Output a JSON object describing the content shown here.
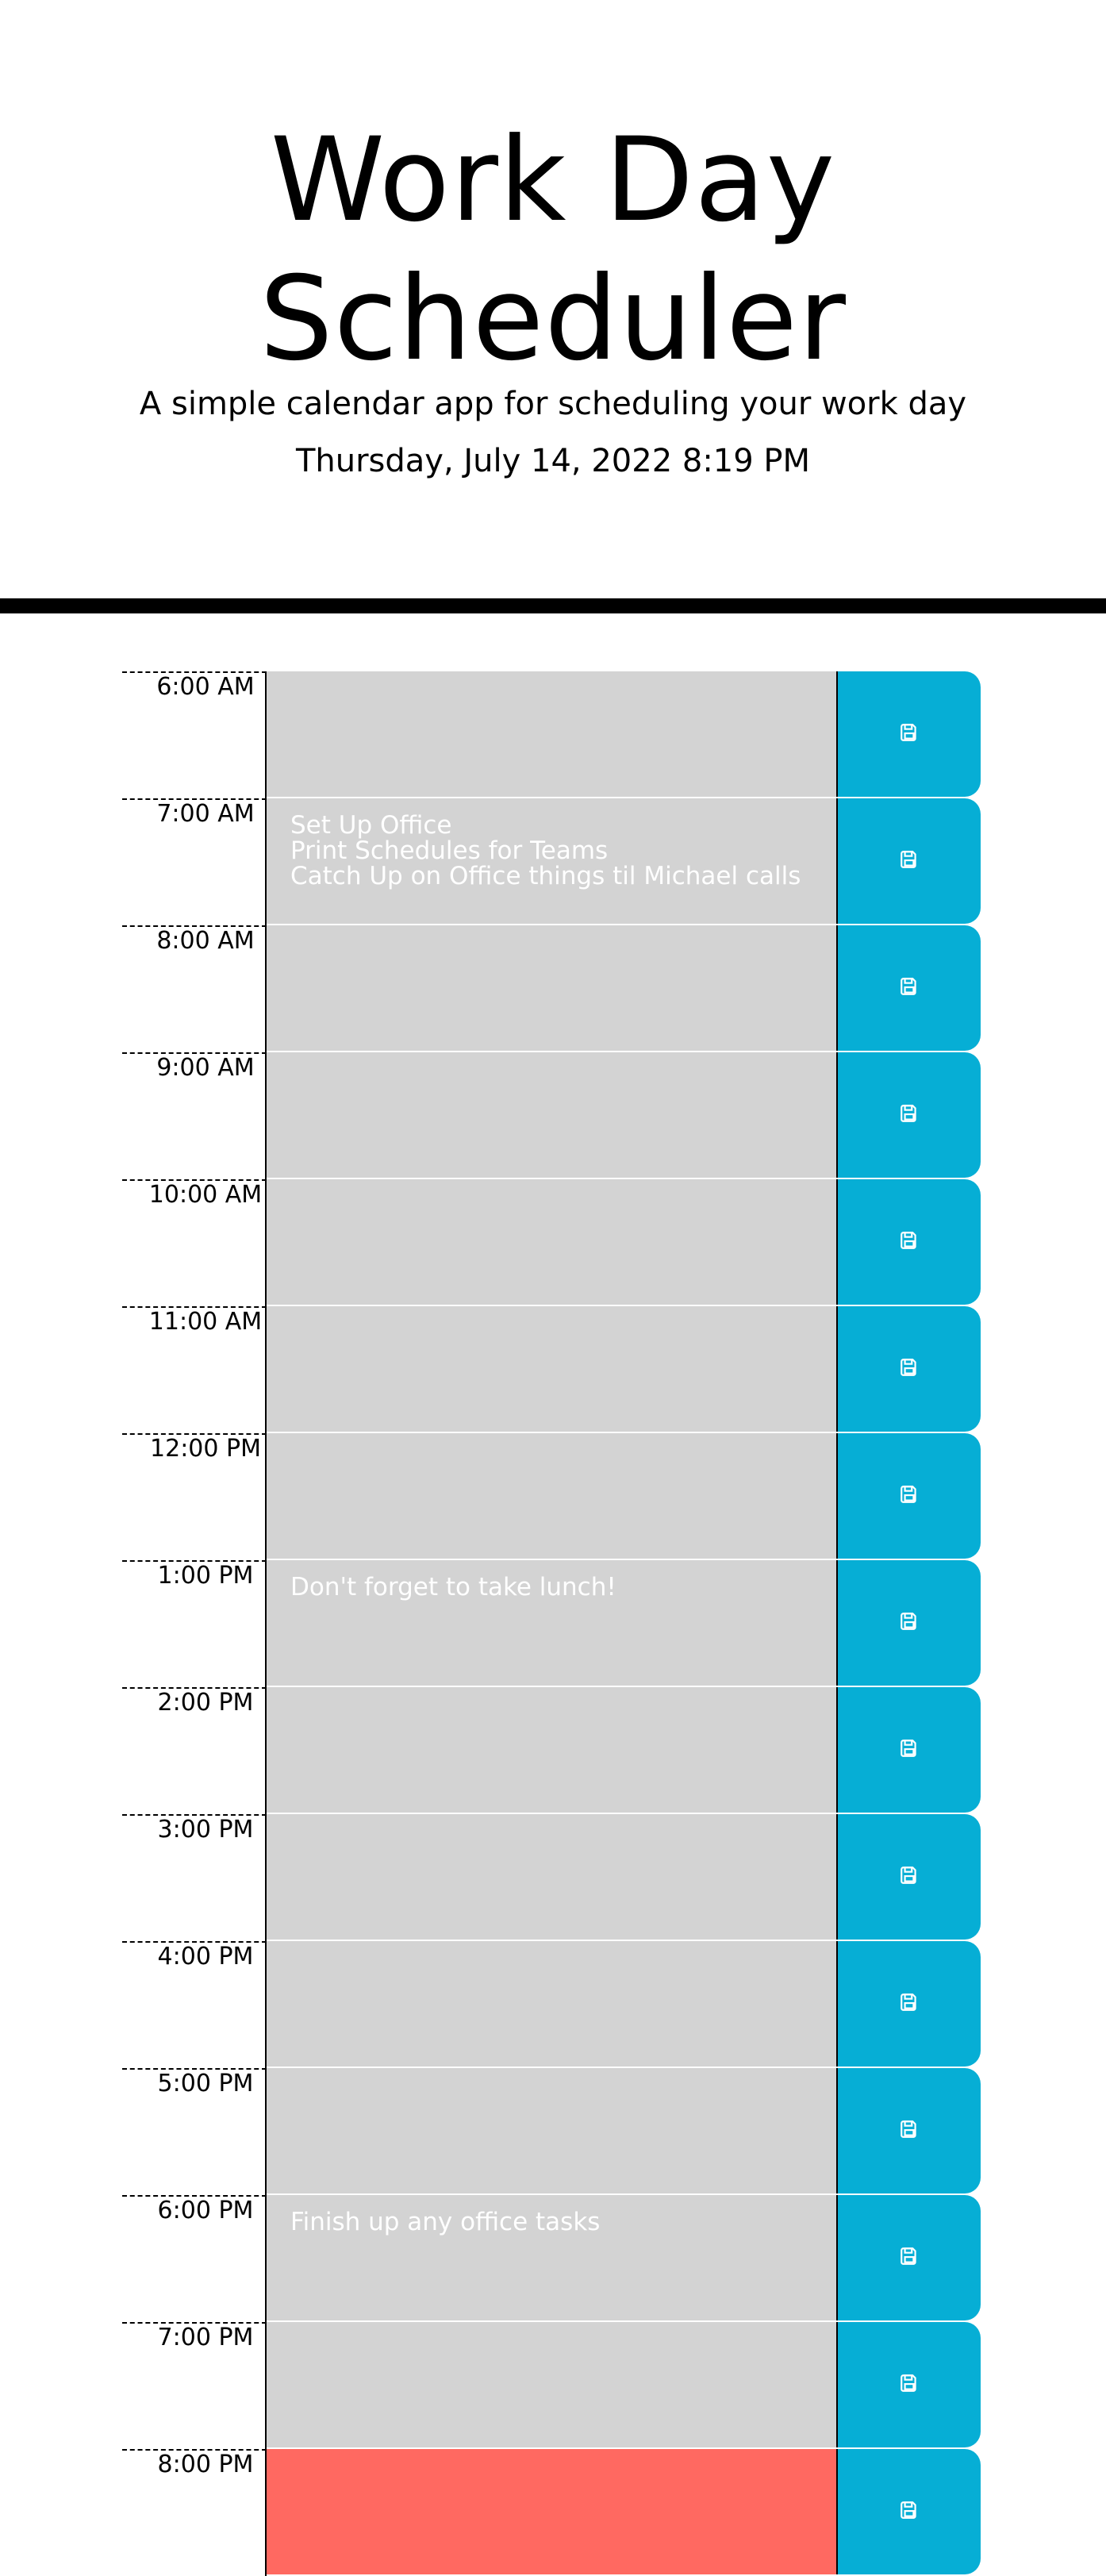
{
  "header": {
    "title": "Work Day Scheduler",
    "subtitle": "A simple calendar app for scheduling your work day",
    "current_day": "Thursday, July 14, 2022 8:19 PM"
  },
  "colors": {
    "past": "#d3d3d3",
    "present": "#ff6961",
    "save_button": "#06aed5"
  },
  "timeblocks": [
    {
      "hour": "6:00 AM",
      "text": "",
      "status": "past"
    },
    {
      "hour": "7:00 AM",
      "text": "Set Up Office\nPrint Schedules for Teams\nCatch Up on Office things til Michael calls",
      "status": "past"
    },
    {
      "hour": "8:00 AM",
      "text": "",
      "status": "past"
    },
    {
      "hour": "9:00 AM",
      "text": "",
      "status": "past"
    },
    {
      "hour": "10:00 AM",
      "text": "",
      "status": "past"
    },
    {
      "hour": "11:00 AM",
      "text": "",
      "status": "past"
    },
    {
      "hour": "12:00 PM",
      "text": "",
      "status": "past"
    },
    {
      "hour": "1:00 PM",
      "text": "Don't forget to take lunch!",
      "status": "past"
    },
    {
      "hour": "2:00 PM",
      "text": "",
      "status": "past"
    },
    {
      "hour": "3:00 PM",
      "text": "",
      "status": "past"
    },
    {
      "hour": "4:00 PM",
      "text": "",
      "status": "past"
    },
    {
      "hour": "5:00 PM",
      "text": "",
      "status": "past"
    },
    {
      "hour": "6:00 PM",
      "text": "Finish up any office tasks",
      "status": "past"
    },
    {
      "hour": "7:00 PM",
      "text": "",
      "status": "past"
    },
    {
      "hour": "8:00 PM",
      "text": "",
      "status": "present"
    }
  ],
  "save_icon": "floppy-disk-icon"
}
